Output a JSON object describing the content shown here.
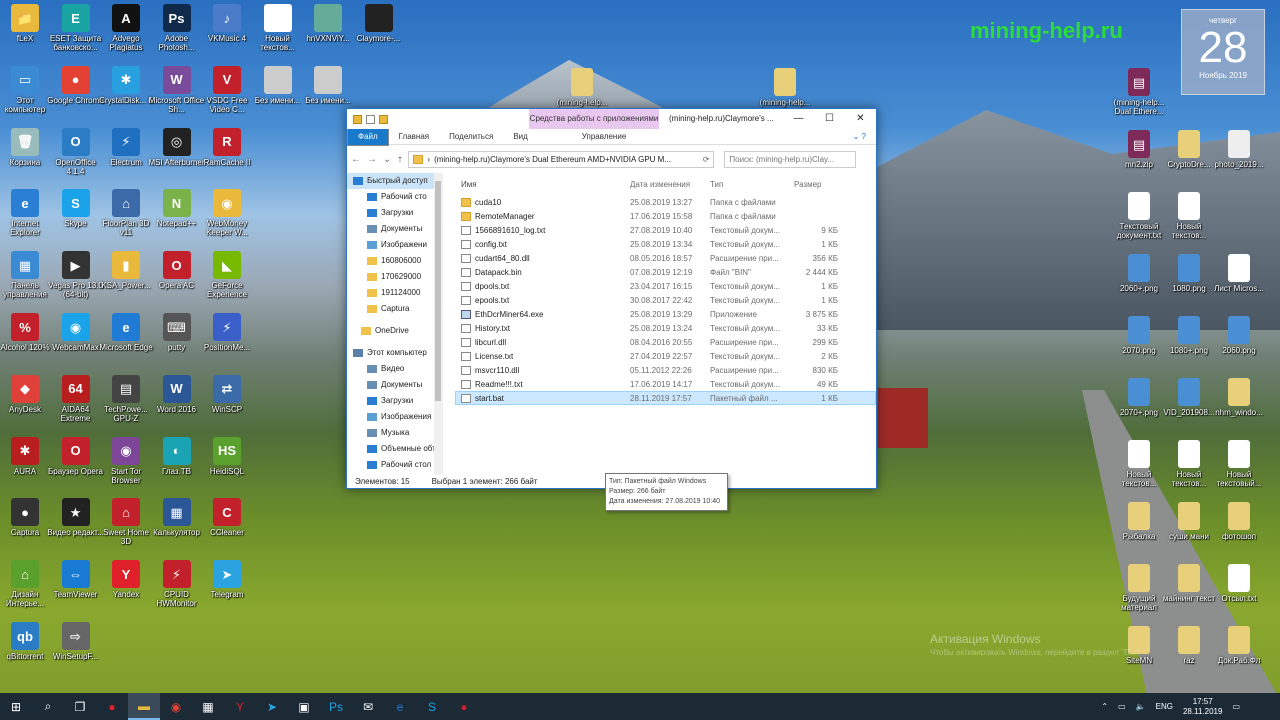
{
  "watermark": "mining-help.ru",
  "calendar": {
    "dow": "четверг",
    "day": "28",
    "month": "Ноябрь 2019"
  },
  "activation": {
    "line1": "Активация Windows",
    "line2": "Чтобы активировать Windows, перейдите в раздел \"П...\""
  },
  "desktop_left": [
    {
      "label": "fLeX",
      "color": "#e8b93a",
      "g": "📁"
    },
    {
      "label": "ESET Защита банковско...",
      "color": "#1aa3a3",
      "g": "E"
    },
    {
      "label": "Advego Plagiatus",
      "color": "#111",
      "g": "A"
    },
    {
      "label": "Adobe Photosh...",
      "color": "#0f2a4a",
      "g": "Ps"
    },
    {
      "label": "VKMusic 4",
      "color": "#4a7cc9",
      "g": "♪"
    },
    {
      "label": "Новый текстов...",
      "color": "#fff",
      "g": ""
    },
    {
      "label": "hnVXNViY...",
      "color": "#6a9",
      "g": ""
    },
    {
      "label": "Claymore-...",
      "color": "#222",
      "g": ""
    },
    {
      "label": "Этот компьютер",
      "color": "#3a8ad4",
      "g": "▭"
    },
    {
      "label": "Google Chrome",
      "color": "#e34133",
      "g": "●"
    },
    {
      "label": "CrystalDisk... 6",
      "color": "#28a0e0",
      "g": "✱"
    },
    {
      "label": "Microsoft Office Sh...",
      "color": "#7a4b9b",
      "g": "W"
    },
    {
      "label": "VSDC Free Video C...",
      "color": "#c2202a",
      "g": "V"
    },
    {
      "label": "Без имени...",
      "color": "#ccc",
      "g": ""
    },
    {
      "label": "Без имени...",
      "color": "#ccc",
      "g": ""
    },
    {
      "label": "Корзина",
      "color": "#9bb",
      "g": "🗑"
    },
    {
      "label": "OpenOffice 4.1.4",
      "color": "#2a7dc4",
      "g": "O"
    },
    {
      "label": "Electrum",
      "color": "#1f6fc0",
      "g": "⚡"
    },
    {
      "label": "MSI Afterburner",
      "color": "#222",
      "g": "◎"
    },
    {
      "label": "RamCache II",
      "color": "#c2202a",
      "g": "R"
    },
    {
      "label": "Internet Explorer",
      "color": "#2a7fd4",
      "g": "e"
    },
    {
      "label": "Skype",
      "color": "#1aa3e8",
      "g": "S"
    },
    {
      "label": "FloorPlan 3D v11",
      "color": "#3a6ba8",
      "g": "⌂"
    },
    {
      "label": "Notepad++",
      "color": "#7ab34a",
      "g": "N"
    },
    {
      "label": "WebMoney Keeper W...",
      "color": "#e8b93a",
      "g": "◉"
    },
    {
      "label": "Панель управления",
      "color": "#3a8ad4",
      "g": "▦"
    },
    {
      "label": "Vegas Pro 13.0 (64-bit)",
      "color": "#333",
      "g": "▶"
    },
    {
      "label": "KSA_Power...",
      "color": "#e8b93a",
      "g": "▮"
    },
    {
      "label": "Opera AC",
      "color": "#c2202a",
      "g": "O"
    },
    {
      "label": "GeForce Experience",
      "color": "#76b900",
      "g": "◣"
    },
    {
      "label": "Alcohol 120%",
      "color": "#c2202a",
      "g": "%"
    },
    {
      "label": "WebcamMax",
      "color": "#1aa3e8",
      "g": "◉"
    },
    {
      "label": "Microsoft Edge",
      "color": "#1f7bd4",
      "g": "e"
    },
    {
      "label": "putty",
      "color": "#555",
      "g": "⌨"
    },
    {
      "label": "PositionMe...",
      "color": "#3a5fc9",
      "g": "⚡"
    },
    {
      "label": "AnyDesk",
      "color": "#e0403a",
      "g": "◆"
    },
    {
      "label": "AIDA64 Extreme",
      "color": "#b81e1e",
      "g": "64"
    },
    {
      "label": "TechPowe... GPU-Z",
      "color": "#444",
      "g": "▤"
    },
    {
      "label": "Word 2016",
      "color": "#2b5797",
      "g": "W"
    },
    {
      "label": "WinSCP",
      "color": "#3a6ba8",
      "g": "⇄"
    },
    {
      "label": "AURA",
      "color": "#b81e1e",
      "g": "✱"
    },
    {
      "label": "Браузер Opera",
      "color": "#c2202a",
      "g": "O"
    },
    {
      "label": "Start Tor Browser",
      "color": "#7d4698",
      "g": "◉"
    },
    {
      "label": "Глаз.ТВ",
      "color": "#1aa3b3",
      "g": "◐"
    },
    {
      "label": "HeidiSQL",
      "color": "#5aa02c",
      "g": "HS"
    },
    {
      "label": "Captura",
      "color": "#333",
      "g": "●"
    },
    {
      "label": "Видео редакт...",
      "color": "#222",
      "g": "★"
    },
    {
      "label": "Sweet Home 3D",
      "color": "#c2202a",
      "g": "⌂"
    },
    {
      "label": "Калькулятор",
      "color": "#2b5797",
      "g": "▦"
    },
    {
      "label": "CCleaner",
      "color": "#c2202a",
      "g": "C"
    },
    {
      "label": "Дизайн Интерье...",
      "color": "#5aa02c",
      "g": "⌂"
    },
    {
      "label": "TeamViewer",
      "color": "#1a7bd4",
      "g": "⇔"
    },
    {
      "label": "Yandex",
      "color": "#e0202a",
      "g": "Y"
    },
    {
      "label": "CPUID HWMonitor",
      "color": "#c2202a",
      "g": "⚡"
    },
    {
      "label": "Telegram",
      "color": "#2aa3e0",
      "g": "➤"
    },
    {
      "label": "qBittorrent",
      "color": "#2a7dc4",
      "g": "qb"
    },
    {
      "label": "WinSetupF...",
      "color": "#666",
      "g": "⇨"
    }
  ],
  "desktop_right": [
    {
      "label": "четверг",
      "hidden": true
    }
  ],
  "desktop_right_icons": [
    {
      "label": "(mining-help...",
      "color": "#e8d07a",
      "g": ""
    },
    {
      "label": "(mining-help...",
      "color": "#e8d07a",
      "g": ""
    },
    {
      "label": "(mining-help... Dual Ethere...",
      "color": "#7d2a5a",
      "g": "▤"
    },
    {
      "label": "mn2.zip",
      "color": "#7d2a5a",
      "g": "▤"
    },
    {
      "label": "CryptoDre...",
      "color": "#e8d07a",
      "g": ""
    },
    {
      "label": "photo_2019...",
      "color": "#eee",
      "g": ""
    },
    {
      "label": "Текстовый документ.txt",
      "color": "#fff",
      "g": ""
    },
    {
      "label": "Новый текстов...",
      "color": "#fff",
      "g": ""
    },
    {
      "label": "2060+.png",
      "color": "#4a8fd4",
      "g": ""
    },
    {
      "label": "1080.png",
      "color": "#4a8fd4",
      "g": ""
    },
    {
      "label": "Лист Micros...",
      "color": "#fff",
      "g": ""
    },
    {
      "label": "2070.png",
      "color": "#4a8fd4",
      "g": ""
    },
    {
      "label": "1080+.png",
      "color": "#4a8fd4",
      "g": ""
    },
    {
      "label": "2060.png",
      "color": "#4a8fd4",
      "g": ""
    },
    {
      "label": "2070+.png",
      "color": "#4a8fd4",
      "g": ""
    },
    {
      "label": "VID_201908...",
      "color": "#4a8fd4",
      "g": ""
    },
    {
      "label": "nhm_windo...",
      "color": "#e8d07a",
      "g": ""
    },
    {
      "label": "Новый текстов...",
      "color": "#fff",
      "g": ""
    },
    {
      "label": "Новый текстов...",
      "color": "#fff",
      "g": ""
    },
    {
      "label": "Новый текстовый...",
      "color": "#fff",
      "g": ""
    },
    {
      "label": "Рыбалка",
      "color": "#e8d07a",
      "g": ""
    },
    {
      "label": "суши мани",
      "color": "#e8d07a",
      "g": ""
    },
    {
      "label": "фотошоп",
      "color": "#e8d07a",
      "g": ""
    },
    {
      "label": "Будущий материал",
      "color": "#e8d07a",
      "g": ""
    },
    {
      "label": "майнинг текст",
      "color": "#e8d07a",
      "g": ""
    },
    {
      "label": "Отсыл.txt",
      "color": "#fff",
      "g": ""
    },
    {
      "label": "SiteMN",
      "color": "#e8d07a",
      "g": ""
    },
    {
      "label": "raz",
      "color": "#e8d07a",
      "g": ""
    },
    {
      "label": "Док.Раб.Фл",
      "color": "#e8d07a",
      "g": ""
    }
  ],
  "explorer": {
    "ctx_tab": "Средства работы с приложениями",
    "title": "(mining-help.ru)Claymore's ...",
    "ribbon": [
      "Файл",
      "Главная",
      "Поделиться",
      "Вид",
      "Управление"
    ],
    "address": "(mining-help.ru)Claymore's Dual Ethereum AMD+NVIDIA GPU M...",
    "search_placeholder": "Поиск: (mining-help.ru)Clay...",
    "sidebar": [
      {
        "label": "Быстрый доступ",
        "kind": "star",
        "sel": true
      },
      {
        "label": "Рабочий сто",
        "kind": "desk"
      },
      {
        "label": "Загрузки",
        "kind": "down"
      },
      {
        "label": "Документы",
        "kind": "doc"
      },
      {
        "label": "Изображени",
        "kind": "img"
      },
      {
        "label": "160806000",
        "kind": "folder"
      },
      {
        "label": "170629000",
        "kind": "folder"
      },
      {
        "label": "191124000",
        "kind": "folder"
      },
      {
        "label": "Captura",
        "kind": "folder"
      },
      {
        "label": "",
        "kind": "gap"
      },
      {
        "label": "OneDrive",
        "kind": "folder"
      },
      {
        "label": "",
        "kind": "gap"
      },
      {
        "label": "Этот компьютер",
        "kind": "pc"
      },
      {
        "label": "Видео",
        "kind": "doc"
      },
      {
        "label": "Документы",
        "kind": "doc"
      },
      {
        "label": "Загрузки",
        "kind": "down"
      },
      {
        "label": "Изображения",
        "kind": "img"
      },
      {
        "label": "Музыка",
        "kind": "doc"
      },
      {
        "label": "Объемные объ",
        "kind": "desk"
      },
      {
        "label": "Рабочий стол",
        "kind": "desk"
      }
    ],
    "columns": [
      "Имя",
      "Дата изменения",
      "Тип",
      "Размер"
    ],
    "files": [
      {
        "name": "cuda10",
        "date": "25.08.2019 13:27",
        "type": "Папка с файлами",
        "size": "",
        "kind": "folder"
      },
      {
        "name": "RemoteManager",
        "date": "17.06.2019 15:58",
        "type": "Папка с файлами",
        "size": "",
        "kind": "folder"
      },
      {
        "name": "1566891610_log.txt",
        "date": "27.08.2019 10:40",
        "type": "Текстовый докум...",
        "size": "9 КБ",
        "kind": "file"
      },
      {
        "name": "config.txt",
        "date": "25.08.2019 13:34",
        "type": "Текстовый докум...",
        "size": "1 КБ",
        "kind": "file"
      },
      {
        "name": "cudart64_80.dll",
        "date": "08.05.2016 18:57",
        "type": "Расширение при...",
        "size": "356 КБ",
        "kind": "file"
      },
      {
        "name": "Datapack.bin",
        "date": "07.08.2019 12:19",
        "type": "Файл \"BIN\"",
        "size": "2 444 КБ",
        "kind": "file"
      },
      {
        "name": "dpools.txt",
        "date": "23.04.2017 16:15",
        "type": "Текстовый докум...",
        "size": "1 КБ",
        "kind": "file"
      },
      {
        "name": "epools.txt",
        "date": "30.08.2017 22:42",
        "type": "Текстовый докум...",
        "size": "1 КБ",
        "kind": "file"
      },
      {
        "name": "EthDcrMiner64.exe",
        "date": "25.08.2019 13:29",
        "type": "Приложение",
        "size": "3 875 КБ",
        "kind": "exe"
      },
      {
        "name": "History.txt",
        "date": "25.08.2019 13:24",
        "type": "Текстовый докум...",
        "size": "33 КБ",
        "kind": "file"
      },
      {
        "name": "libcurl.dll",
        "date": "08.04.2016 20:55",
        "type": "Расширение при...",
        "size": "299 КБ",
        "kind": "file"
      },
      {
        "name": "License.txt",
        "date": "27.04.2019 22:57",
        "type": "Текстовый докум...",
        "size": "2 КБ",
        "kind": "file"
      },
      {
        "name": "msvcr110.dll",
        "date": "05.11.2012 22:26",
        "type": "Расширение при...",
        "size": "830 КБ",
        "kind": "file"
      },
      {
        "name": "Readme!!!.txt",
        "date": "17.06.2019 14:17",
        "type": "Текстовый докум...",
        "size": "49 КБ",
        "kind": "file"
      },
      {
        "name": "start.bat",
        "date": "28.11.2019 17:57",
        "type": "Пакетный файл ...",
        "size": "1 КБ",
        "kind": "file",
        "sel": true
      }
    ],
    "tooltip": [
      "Тип: Пакетный файл Windows",
      "Размер: 266 байт",
      "Дата изменения: 27.08.2019 10:40"
    ],
    "status_count": "Элементов: 15",
    "status_sel": "Выбран 1 элемент: 266 байт"
  },
  "taskbar": {
    "lang": "ENG",
    "time": "17:57",
    "date": "28.11.2019"
  }
}
